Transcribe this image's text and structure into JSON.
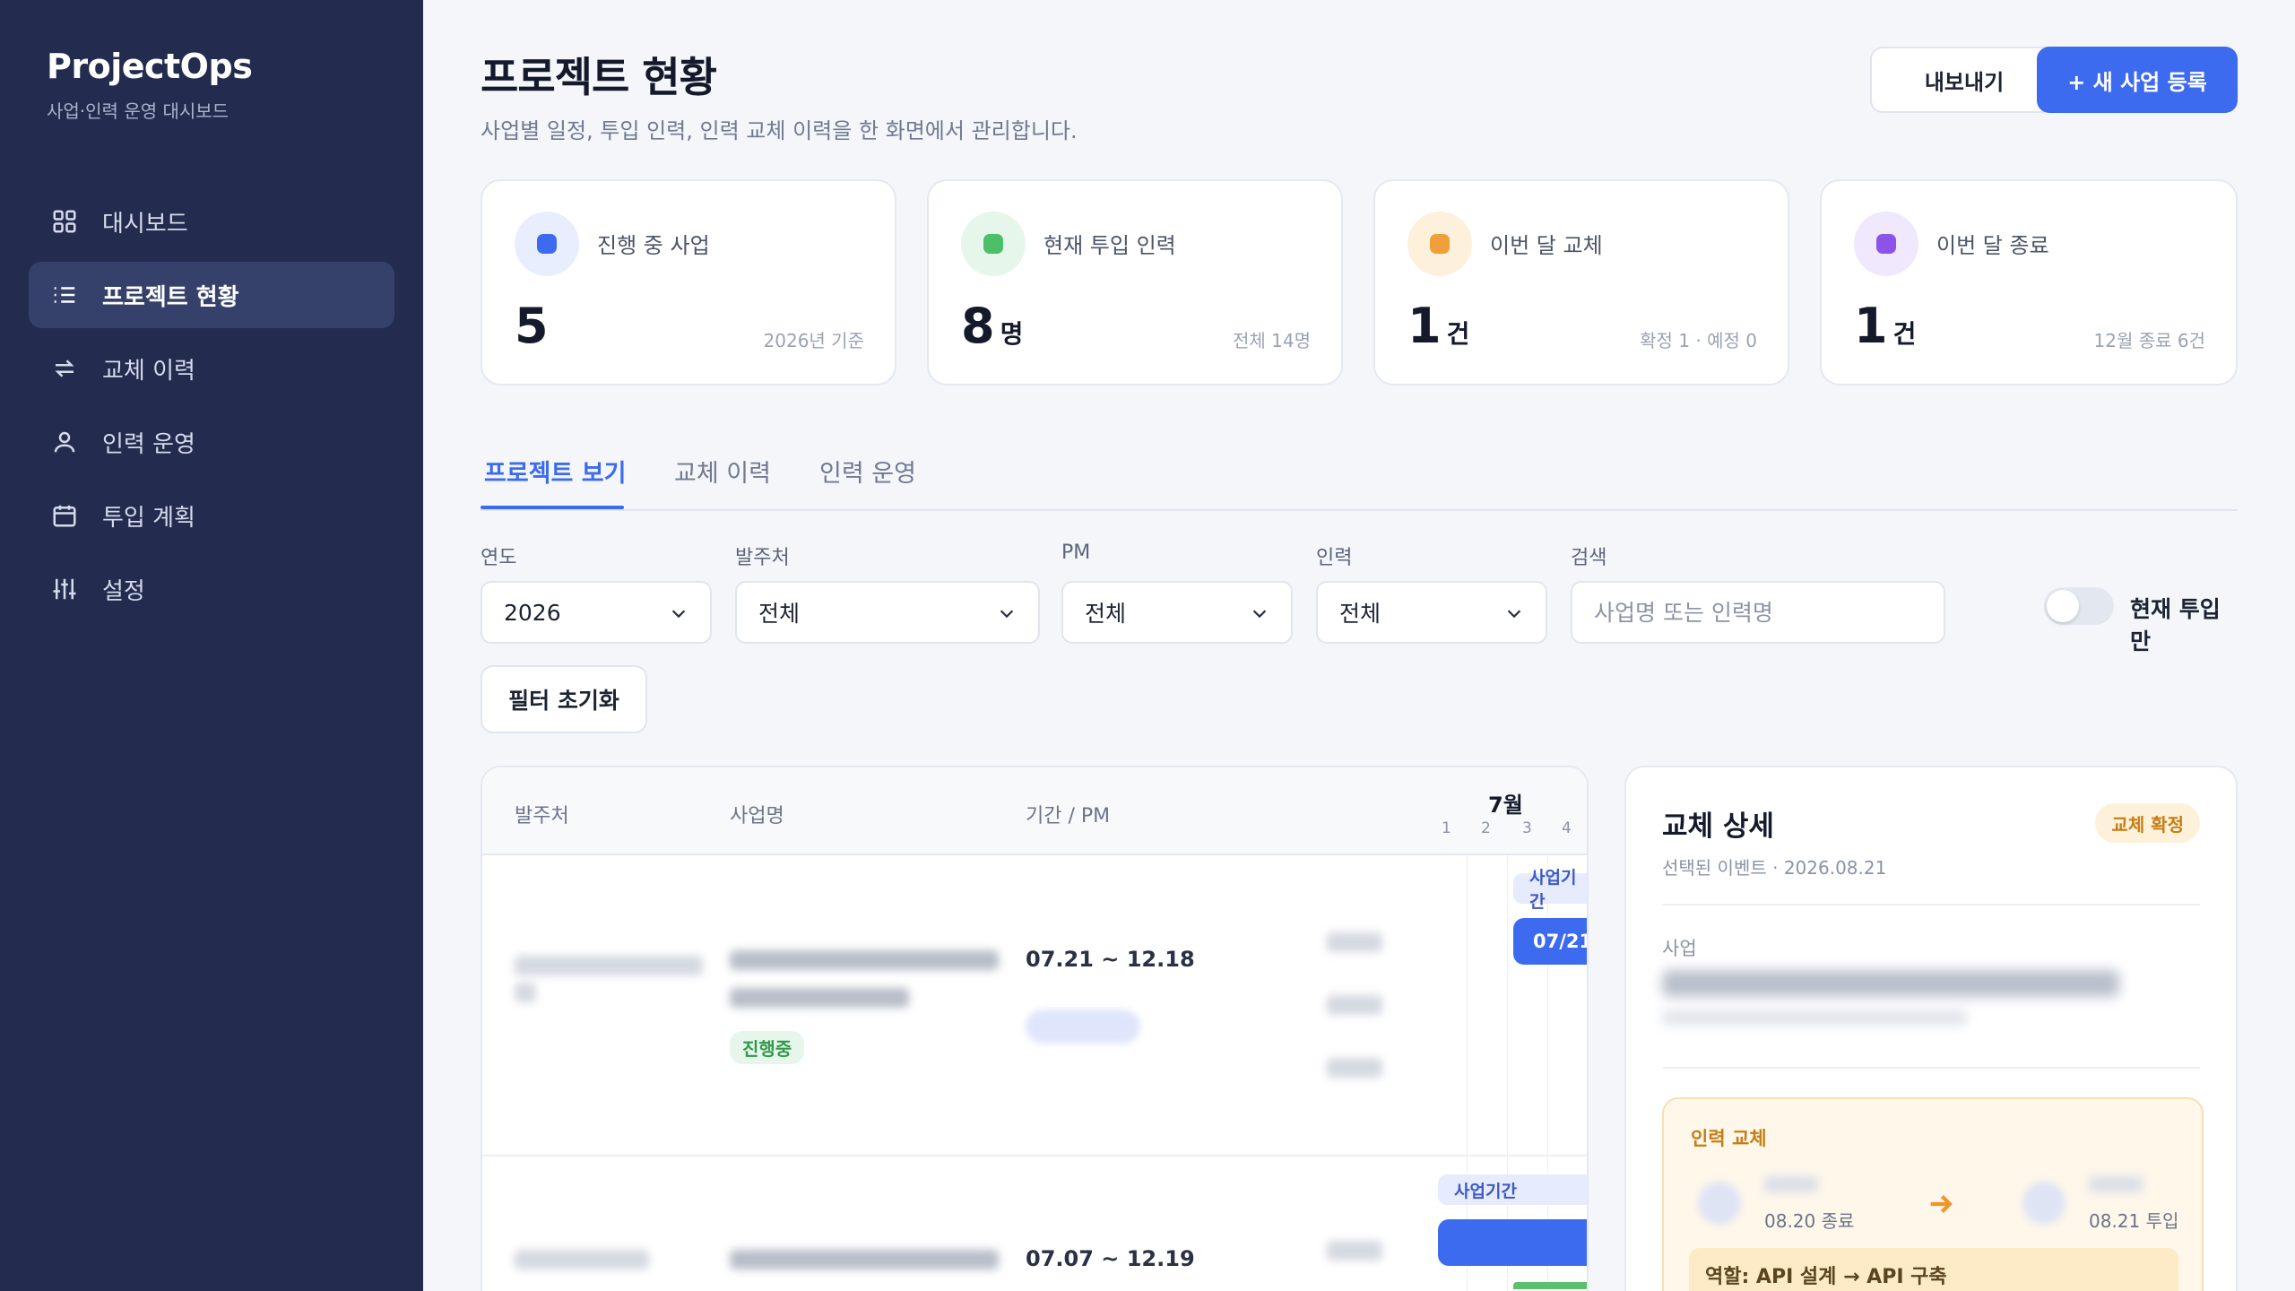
{
  "app": {
    "title": "ProjectOps",
    "subtitle": "사업·인력 운영 대시보드"
  },
  "sidebar": {
    "items": [
      {
        "label": "대시보드",
        "icon": "grid-icon",
        "active": false
      },
      {
        "label": "프로젝트 현황",
        "icon": "list-icon",
        "active": true
      },
      {
        "label": "교체 이력",
        "icon": "swap-icon",
        "active": false
      },
      {
        "label": "인력 운영",
        "icon": "user-icon",
        "active": false
      },
      {
        "label": "투입 계획",
        "icon": "calendar-icon",
        "active": false
      },
      {
        "label": "설정",
        "icon": "sliders-icon",
        "active": false
      }
    ]
  },
  "header": {
    "title": "프로젝트 현황",
    "subtitle": "사업별 일정, 투입 인력, 인력 교체 이력을 한 화면에서 관리합니다.",
    "export_label": "내보내기",
    "new_label": "+ 새 사업 등록"
  },
  "stats": [
    {
      "label": "진행 중 사업",
      "value": "5",
      "unit": "",
      "note": "2026년 기준",
      "color": "#3d6bf0",
      "bg": "#e8eefd"
    },
    {
      "label": "현재 투입 인력",
      "value": "8",
      "unit": "명",
      "note": "전체 14명",
      "color": "#4cbf68",
      "bg": "#e6f6ea"
    },
    {
      "label": "이번 달 교체",
      "value": "1",
      "unit": "건",
      "note": "확정 1 · 예정 0",
      "color": "#f0a03a",
      "bg": "#fdf1dc"
    },
    {
      "label": "이번 달 종료",
      "value": "1",
      "unit": "건",
      "note": "12월 종료 6건",
      "color": "#8b53e8",
      "bg": "#f0e8fd"
    }
  ],
  "tabs": [
    {
      "label": "프로젝트 보기",
      "active": true
    },
    {
      "label": "교체 이력",
      "active": false
    },
    {
      "label": "인력 운영",
      "active": false
    }
  ],
  "filters": {
    "year": {
      "label": "연도",
      "value": "2026"
    },
    "client": {
      "label": "발주처",
      "value": "전체"
    },
    "pm": {
      "label": "PM",
      "value": "전체"
    },
    "staff": {
      "label": "인력",
      "value": "전체"
    },
    "search": {
      "label": "검색",
      "placeholder": "사업명 또는 인력명"
    },
    "current_only": {
      "label": "현재 투입만",
      "on": false
    },
    "reset_label": "필터 초기화"
  },
  "table": {
    "headers": {
      "client": "발주처",
      "name": "사업명",
      "period_pm": "기간 / PM"
    },
    "month": "7월",
    "days": [
      "1",
      "2",
      "3",
      "4"
    ],
    "rows": [
      {
        "period": "07.21 ~ 12.18",
        "status": "진행중",
        "bar_tag": "사업기간",
        "bar_label": "07/21"
      },
      {
        "period": "07.07 ~ 12.19",
        "status": "",
        "bar_tag": "사업기간",
        "bar_label": ""
      }
    ]
  },
  "detail": {
    "title": "교체 상세",
    "badge": "교체 확정",
    "subtitle": "선택된 이벤트 · 2026.08.21",
    "project_label": "사업",
    "swap_title": "인력 교체",
    "out_date": "08.20 종료",
    "in_date": "08.21 투입",
    "role": "역할: API 설계 → API 구축"
  }
}
